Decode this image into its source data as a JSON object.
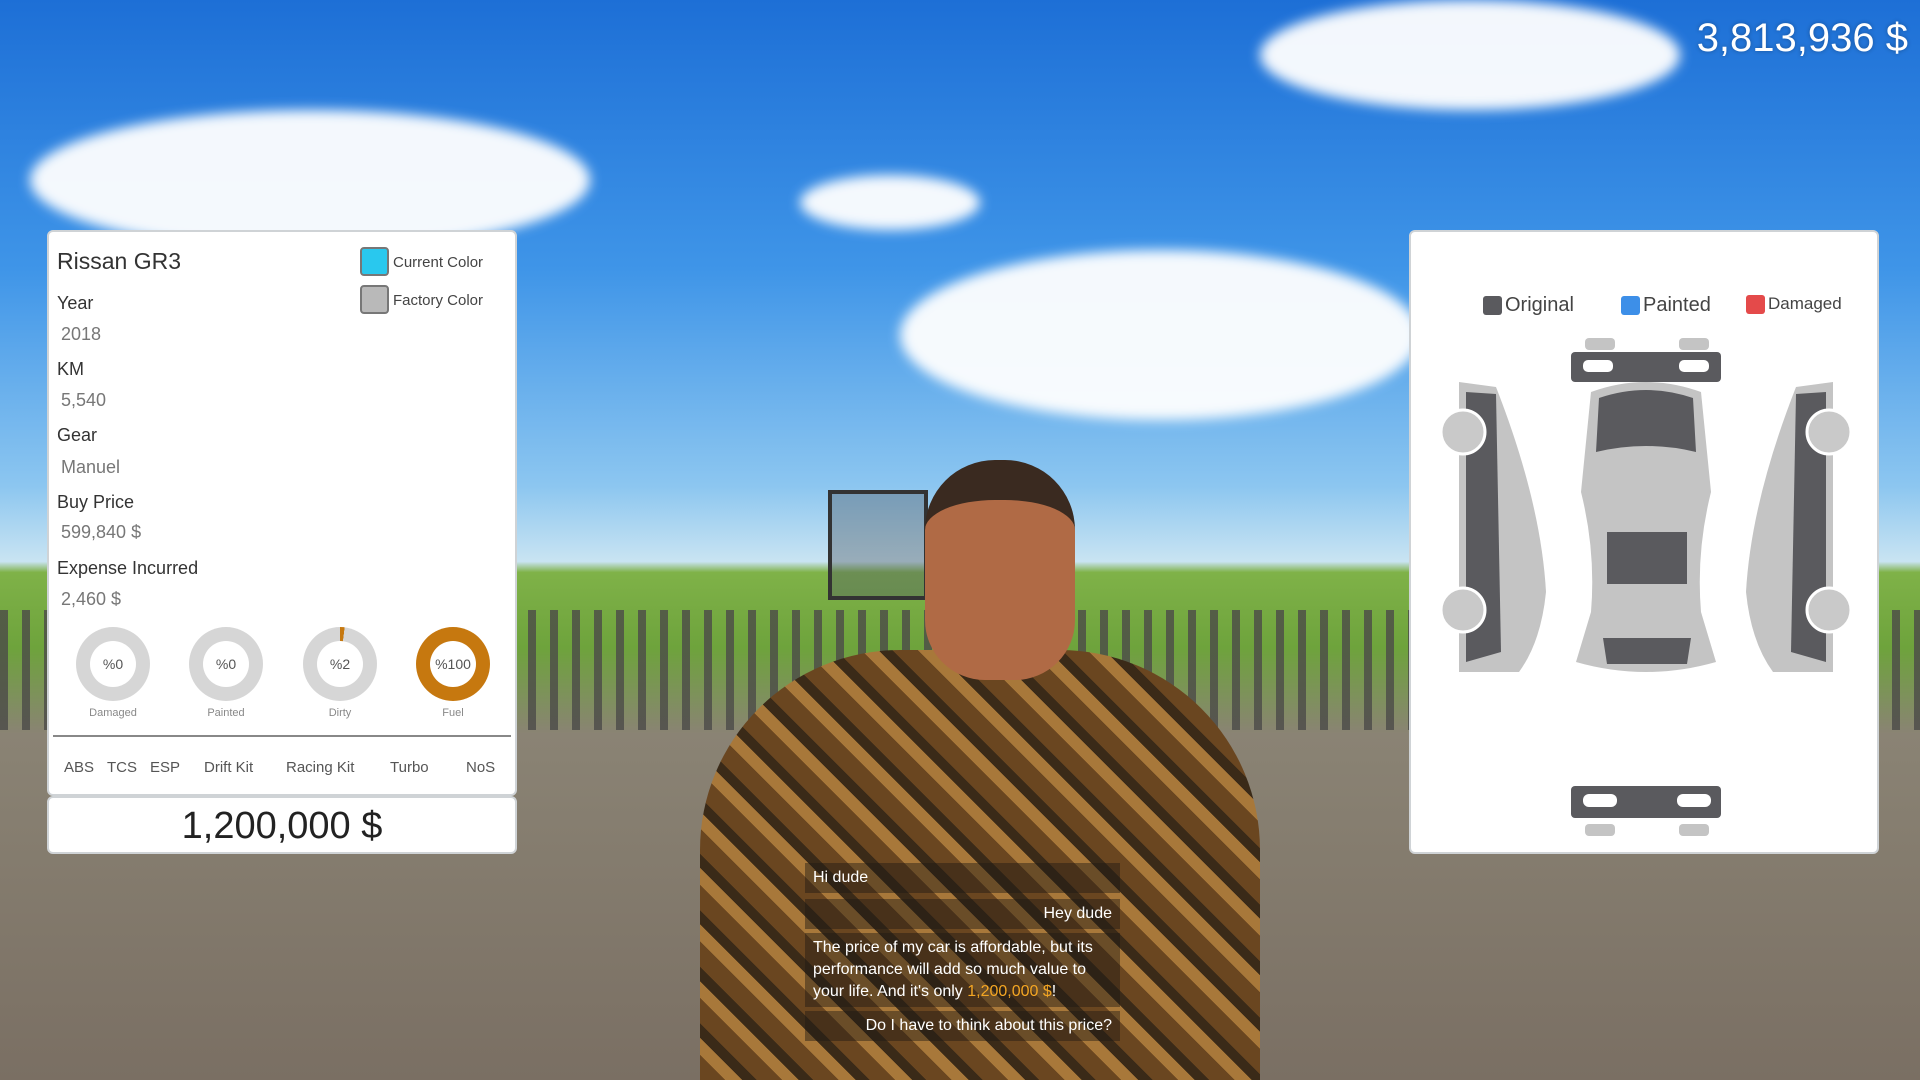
{
  "hud": {
    "money": "3,813,936 $"
  },
  "car_info": {
    "name": "Rissan GR3",
    "current_color_label": "Current Color",
    "current_color": "#29c8ee",
    "factory_color_label": "Factory Color",
    "factory_color": "#b9b9b9",
    "fields": [
      {
        "label": "Year",
        "value": "2018"
      },
      {
        "label": "KM",
        "value": "5,540"
      },
      {
        "label": "Gear",
        "value": "Manuel"
      },
      {
        "label": "Buy Price",
        "value": "599,840 $"
      },
      {
        "label": "Expense Incurred",
        "value": "2,460 $"
      }
    ],
    "gauges": [
      {
        "label": "Damaged",
        "text": "%0",
        "percent": 0
      },
      {
        "label": "Painted",
        "text": "%0",
        "percent": 0
      },
      {
        "label": "Dirty",
        "text": "%2",
        "percent": 2
      },
      {
        "label": "Fuel",
        "text": "%100",
        "percent": 100
      }
    ],
    "gauge_color": "#c6780f",
    "features": [
      "ABS",
      "TCS",
      "ESP",
      "Drift Kit",
      "Racing Kit",
      "Turbo",
      "NoS"
    ],
    "price": "1,200,000 $"
  },
  "damage_panel": {
    "legend": [
      {
        "label": "Original",
        "color": "#5a5a5e"
      },
      {
        "label": "Painted",
        "color": "#3d8fe8"
      },
      {
        "label": "Damaged",
        "color": "#e44a4a"
      }
    ]
  },
  "dialog": {
    "npc_1": "Hi dude",
    "player_1": "Hey dude",
    "npc_2": "The price of my car is affordable, but its performance will add so much value to your life. And it's only ",
    "npc_2_price": "1,200,000 $",
    "npc_2_end": "!",
    "player_option": "Do I have to think about this price?"
  }
}
